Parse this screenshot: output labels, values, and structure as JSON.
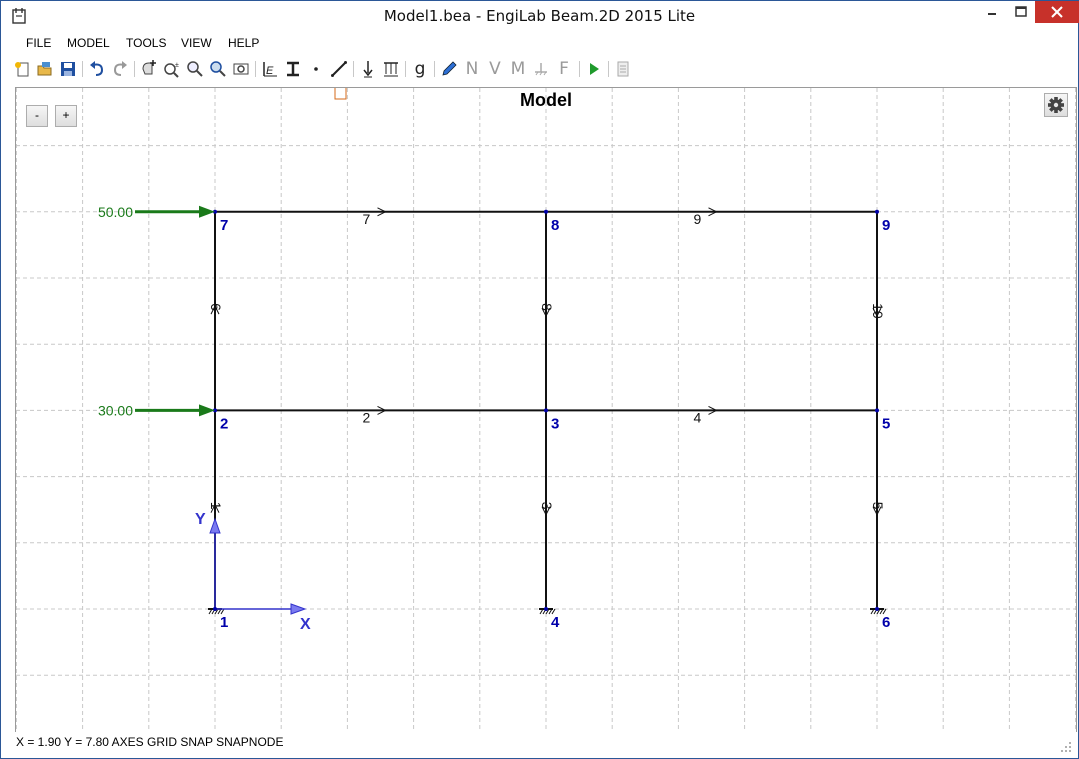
{
  "window": {
    "title": "Model1.bea - EngiLab Beam.2D 2015 Lite",
    "close_color": "#c7312a"
  },
  "menu": {
    "items": [
      {
        "label": "FILE"
      },
      {
        "label": "MODEL"
      },
      {
        "label": "TOOLS"
      },
      {
        "label": "VIEW"
      },
      {
        "label": "HELP"
      }
    ]
  },
  "toolbar": {
    "groups": [
      [
        "new-icon",
        "open-icon",
        "save-icon"
      ],
      [
        "undo-icon",
        "redo-icon"
      ],
      [
        "pan-icon",
        "zoom-in-out-icon",
        "zoom-window-icon",
        "zoom-extents-icon",
        "zoom-previous-icon"
      ],
      [
        "material-icon",
        "section-icon",
        "node-icon",
        "element-icon"
      ],
      [
        "point-load-icon",
        "distributed-load-icon"
      ],
      [
        "gravity-icon"
      ],
      [
        "edit-icon",
        "axial-result-icon",
        "shear-result-icon",
        "moment-result-icon",
        "support-result-icon",
        "force-result-icon"
      ],
      [
        "run-icon"
      ],
      [
        "report-icon"
      ]
    ],
    "result_letters": {
      "axial": "N",
      "shear": "V",
      "moment": "M",
      "force": "F"
    },
    "gravity_letter": "g"
  },
  "canvas": {
    "title": "Model",
    "zoom_out_label": "-",
    "zoom_in_label": "+",
    "axis_x_label": "X",
    "axis_y_label": "Y",
    "node_color": "#0000aa",
    "load_color": "#1a7a1a",
    "axis_color": "#3333cc",
    "nodes": [
      {
        "id": "1",
        "x": 0,
        "y": 0
      },
      {
        "id": "2",
        "x": 0,
        "y": 3
      },
      {
        "id": "3",
        "x": 5,
        "y": 3
      },
      {
        "id": "4",
        "x": 5,
        "y": 0
      },
      {
        "id": "5",
        "x": 10,
        "y": 3
      },
      {
        "id": "6",
        "x": 10,
        "y": 0
      },
      {
        "id": "7",
        "x": 0,
        "y": 6
      },
      {
        "id": "8",
        "x": 5,
        "y": 6
      },
      {
        "id": "9",
        "x": 10,
        "y": 6
      }
    ],
    "elements": [
      {
        "id": "1",
        "from": "1",
        "to": "2"
      },
      {
        "id": "2",
        "from": "2",
        "to": "3"
      },
      {
        "id": "3",
        "from": "3",
        "to": "4"
      },
      {
        "id": "4",
        "from": "3",
        "to": "5"
      },
      {
        "id": "5",
        "from": "5",
        "to": "6"
      },
      {
        "id": "6",
        "from": "2",
        "to": "7"
      },
      {
        "id": "7",
        "from": "7",
        "to": "8"
      },
      {
        "id": "8",
        "from": "8",
        "to": "3"
      },
      {
        "id": "9",
        "from": "8",
        "to": "9"
      },
      {
        "id": "10",
        "from": "9",
        "to": "5"
      }
    ],
    "supports": [
      "1",
      "4",
      "6"
    ],
    "loads": [
      {
        "node": "7",
        "value": "50.00"
      },
      {
        "node": "2",
        "value": "30.00"
      }
    ]
  },
  "status": {
    "text": "X = 1.90  Y = 7.80  AXES  GRID  SNAP  SNAPNODE"
  }
}
